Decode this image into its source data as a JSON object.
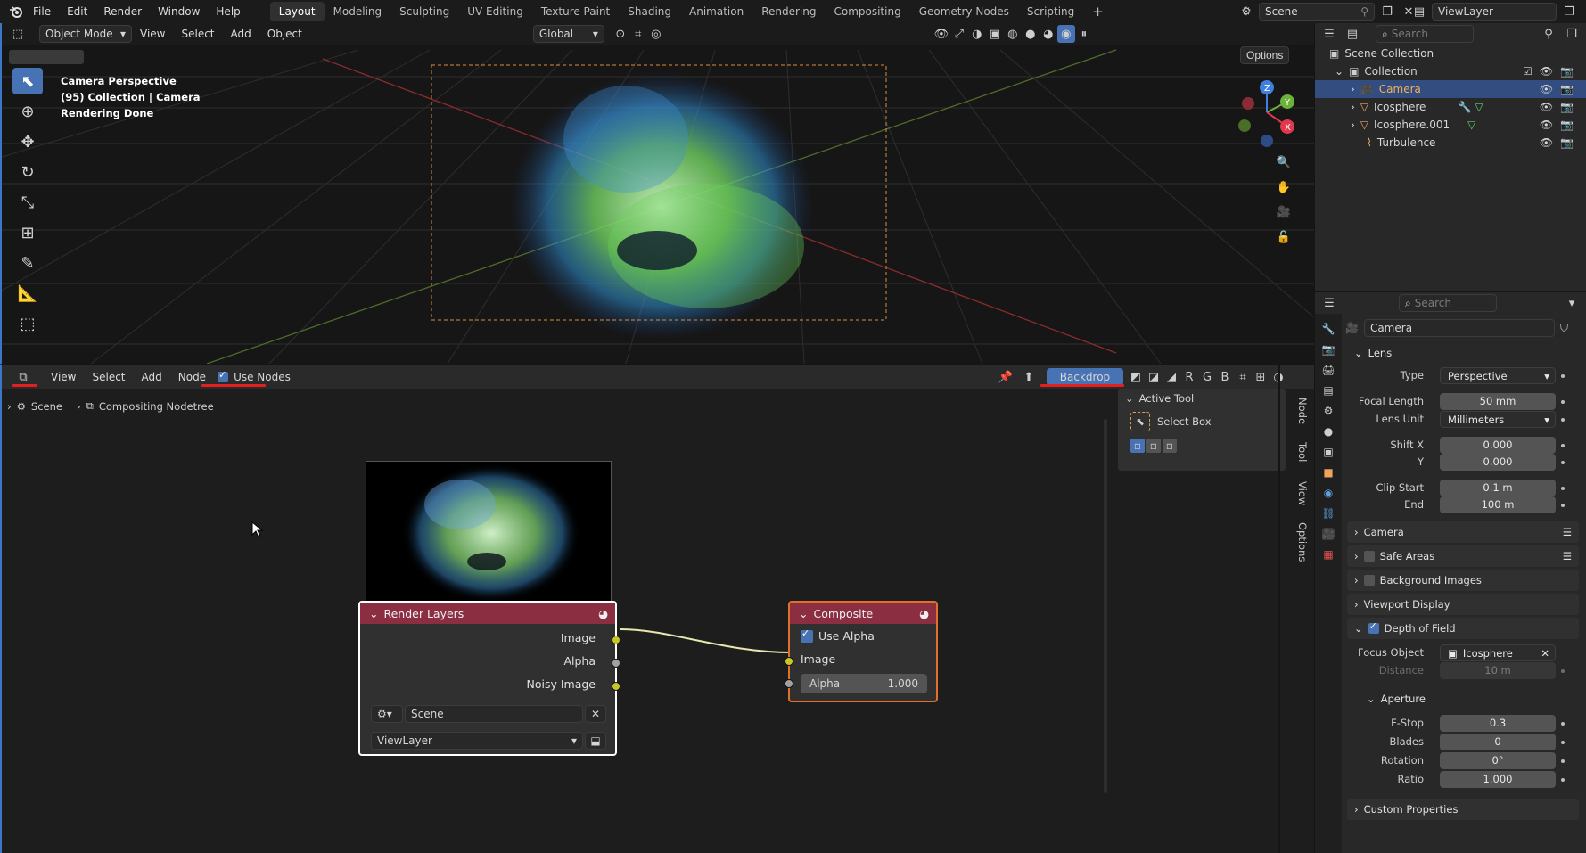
{
  "topbar": {
    "menus": [
      "File",
      "Edit",
      "Render",
      "Window",
      "Help"
    ],
    "workspaces": [
      "Layout",
      "Modeling",
      "Sculpting",
      "UV Editing",
      "Texture Paint",
      "Shading",
      "Animation",
      "Rendering",
      "Compositing",
      "Geometry Nodes",
      "Scripting"
    ],
    "active_workspace": "Layout",
    "add_tab": "+",
    "scene": "Scene",
    "view_layer": "ViewLayer"
  },
  "viewport": {
    "mode": "Object Mode",
    "menus": [
      "View",
      "Select",
      "Add",
      "Object"
    ],
    "transform_orientation": "Global",
    "options_label": "Options",
    "info_line1": "Camera Perspective",
    "info_line2": "(95) Collection | Camera",
    "info_line3": "Rendering Done",
    "gizmo_axes": [
      "Z",
      "Y",
      "X"
    ]
  },
  "outliner": {
    "search_placeholder": "Search",
    "scene_collection": "Scene Collection",
    "collection": "Collection",
    "items": [
      {
        "name": "Camera",
        "icon": "camera-icon",
        "selected": true
      },
      {
        "name": "Icosphere",
        "icon": "mesh-icon",
        "selected": false
      },
      {
        "name": "Icosphere.001",
        "icon": "mesh-icon",
        "selected": false
      },
      {
        "name": "Turbulence",
        "icon": "force-field-icon",
        "selected": false
      }
    ]
  },
  "properties": {
    "search_placeholder": "Search",
    "object_name": "Camera",
    "lens_section": "Lens",
    "type_label": "Type",
    "type_value": "Perspective",
    "focal_length_label": "Focal Length",
    "focal_length_value": "50 mm",
    "lens_unit_label": "Lens Unit",
    "lens_unit_value": "Millimeters",
    "shift_x_label": "Shift X",
    "shift_x_value": "0.000",
    "shift_y_label": "Y",
    "shift_y_value": "0.000",
    "clip_start_label": "Clip Start",
    "clip_start_value": "0.1 m",
    "clip_end_label": "End",
    "clip_end_value": "100 m",
    "camera_section": "Camera",
    "safe_areas_section": "Safe Areas",
    "background_images_section": "Background Images",
    "viewport_display_section": "Viewport Display",
    "dof_section": "Depth of Field",
    "focus_object_label": "Focus Object",
    "focus_object_value": "Icosphere",
    "distance_label": "Distance",
    "distance_value": "10 m",
    "aperture_section": "Aperture",
    "fstop_label": "F-Stop",
    "fstop_value": "0.3",
    "blades_label": "Blades",
    "blades_value": "0",
    "rotation_label": "Rotation",
    "rotation_value": "0°",
    "ratio_label": "Ratio",
    "ratio_value": "1.000",
    "custom_props_section": "Custom Properties"
  },
  "node_editor": {
    "menus": [
      "View",
      "Select",
      "Add",
      "Node"
    ],
    "use_nodes_label": "Use Nodes",
    "backdrop_label": "Backdrop",
    "channel_buttons": [
      "R",
      "G",
      "B"
    ],
    "breadcrumb_scene": "Scene",
    "breadcrumb_tree": "Compositing Nodetree",
    "side_panel_title": "Active Tool",
    "side_panel_tool": "Select Box",
    "vertical_tabs": [
      "Node",
      "Tool",
      "View",
      "Options"
    ],
    "render_layers_node": {
      "title": "Render Layers",
      "outputs": [
        "Image",
        "Alpha",
        "Noisy Image"
      ],
      "scene": "Scene",
      "view_layer": "ViewLayer"
    },
    "composite_node": {
      "title": "Composite",
      "use_alpha_label": "Use Alpha",
      "image_input": "Image",
      "alpha_label": "Alpha",
      "alpha_value": "1.000"
    }
  },
  "colors": {
    "accent_blue": "#4772b3",
    "render_layers_header": "#8c2e42",
    "composite_header": "#8c2e42",
    "socket_yellow": "#c7c729",
    "underline_red": "#e51f1f"
  }
}
